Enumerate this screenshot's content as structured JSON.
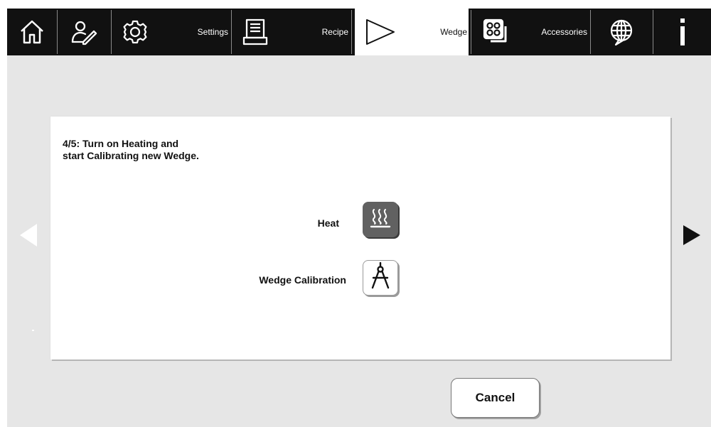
{
  "toolbar": {
    "items": [
      {
        "name": "home",
        "icon": "home-icon",
        "label": ""
      },
      {
        "name": "edit",
        "icon": "edit-user-icon",
        "label": ""
      },
      {
        "name": "settings",
        "icon": "gear-icon",
        "label": "Settings"
      },
      {
        "name": "recipe",
        "icon": "recipe-icon",
        "label": "Recipe"
      },
      {
        "name": "wedge",
        "icon": "wedge-icon",
        "label": "Wedge",
        "active": true
      },
      {
        "name": "accessories",
        "icon": "accessories-icon",
        "label": "Accessories"
      },
      {
        "name": "language",
        "icon": "globe-icon",
        "label": ""
      },
      {
        "name": "info",
        "icon": "info-icon",
        "label": ""
      }
    ]
  },
  "dialog": {
    "step_text": "4/5: Turn on Heating and\nstart Calibrating new Wedge.",
    "heat_label": "Heat",
    "heat_icon": "heat-icon",
    "calibration_label": "Wedge Calibration",
    "calibration_icon": "compass-icon"
  },
  "navigation": {
    "prev_icon": "arrow-left-icon",
    "next_icon": "arrow-right-icon"
  },
  "cancel_label": "Cancel",
  "colors": {
    "toolbar_bg": "#111111",
    "content_bg": "#e6e6e6",
    "card_bg": "#ffffff",
    "heat_button_bg": "#616161"
  }
}
